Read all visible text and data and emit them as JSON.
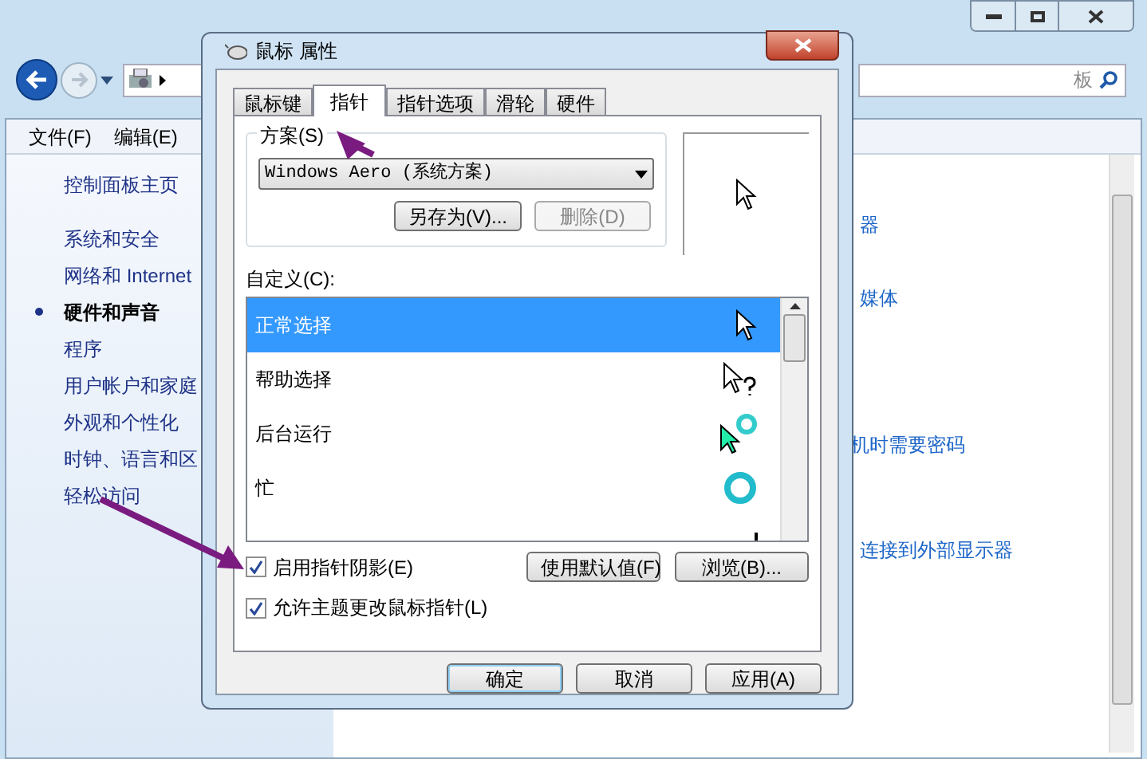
{
  "explorer": {
    "search": {
      "placeholder": "板"
    },
    "menu": [
      "文件(F)",
      "编辑(E)"
    ],
    "sidebar": [
      {
        "label": "控制面板主页",
        "selected": false
      },
      {
        "label": "系统和安全",
        "selected": false
      },
      {
        "label": "网络和 Internet",
        "selected": false
      },
      {
        "label": "硬件和声音",
        "selected": true
      },
      {
        "label": "程序",
        "selected": false
      },
      {
        "label": "用户帐户和家庭",
        "selected": false
      },
      {
        "label": "外观和个性化",
        "selected": false
      },
      {
        "label": "时钟、语言和区",
        "selected": false
      },
      {
        "label": "轻松访问",
        "selected": false
      }
    ],
    "links": [
      "器",
      "媒体",
      "机时需要密码",
      "连接到外部显示器"
    ]
  },
  "dialog": {
    "title": "鼠标 属性",
    "tabs": [
      {
        "label": "鼠标键",
        "selected": false
      },
      {
        "label": "指针",
        "selected": true
      },
      {
        "label": "指针选项",
        "selected": false
      },
      {
        "label": "滑轮",
        "selected": false
      },
      {
        "label": "硬件",
        "selected": false
      }
    ],
    "scheme": {
      "label": "方案(S)",
      "value": "Windows Aero (系统方案)",
      "buttons": [
        {
          "label": "另存为(V)...",
          "disabled": false
        },
        {
          "label": "删除(D)",
          "disabled": true
        }
      ]
    },
    "customize_label": "自定义(C):",
    "cursors": [
      {
        "name": "正常选择",
        "kind": "arrow",
        "selected": true
      },
      {
        "name": "帮助选择",
        "kind": "help",
        "selected": false
      },
      {
        "name": "后台运行",
        "kind": "working",
        "selected": false
      },
      {
        "name": "忙",
        "kind": "busy",
        "selected": false
      },
      {
        "kind": "text",
        "selected": false
      }
    ],
    "shadow": {
      "label": "启用指针阴影(E)",
      "checked": true
    },
    "action_buttons": [
      "使用默认值(F)",
      "浏览(B)..."
    ],
    "theme": {
      "label": "允许主题更改鼠标指针(L)",
      "checked": true
    },
    "footer_buttons": [
      {
        "label": "确定",
        "default": true
      },
      {
        "label": "取消",
        "default": false
      },
      {
        "label": "应用(A)",
        "default": false
      }
    ]
  }
}
